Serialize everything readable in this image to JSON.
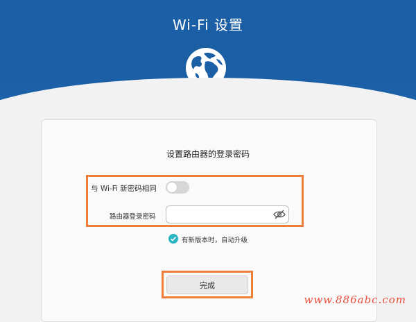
{
  "header": {
    "title": "Wi-Fi 设置",
    "icon": "globe-icon",
    "color": "#1b5fa6"
  },
  "card": {
    "title": "设置路由器的登录密码",
    "same_as_wifi": {
      "label": "与 Wi-Fi 新密码相同",
      "enabled": false
    },
    "router_password": {
      "label": "路由器登录密码",
      "value": "",
      "placeholder": "",
      "icon": "eye-hidden-icon"
    },
    "auto_upgrade": {
      "label": "有新版本时，自动升级",
      "checked": true,
      "icon": "check-circle-icon",
      "color": "#2ab5c2"
    },
    "done_button": {
      "label": "完成"
    }
  },
  "highlight_color": "#ef7d3a",
  "watermark": "www.886abc.com"
}
